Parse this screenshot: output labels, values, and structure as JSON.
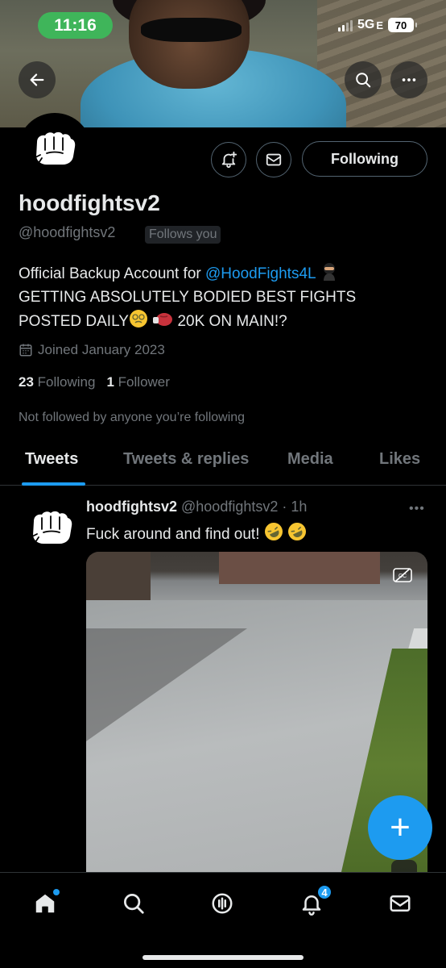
{
  "status_bar": {
    "time": "11:16",
    "network": "5G",
    "network_suffix": "E",
    "battery": "70"
  },
  "header": {
    "back_icon": "arrow-left-icon",
    "search_icon": "search-icon",
    "more_icon": "more-horizontal-icon"
  },
  "profile": {
    "display_name": "hoodfightsv2",
    "handle": "@hoodfightsv2",
    "follows_you": "Follows you",
    "following_button": "Following",
    "bio_prefix": "Official Backup Account for ",
    "bio_mention": "@HoodFights4L",
    "bio_line2": "GETTING ABSOLUTELY BODIED BEST FIGHTS",
    "bio_line3_a": "POSTED DAILY",
    "bio_line3_b": " 20K ON MAIN!?",
    "joined": "Joined January 2023",
    "following_count": "23",
    "following_label": "Following",
    "follower_count": "1",
    "follower_label": "Follower",
    "not_followed": "Not followed by anyone you’re following"
  },
  "tabs": [
    {
      "label": "Tweets",
      "active": true
    },
    {
      "label": "Tweets & replies"
    },
    {
      "label": "Media"
    },
    {
      "label": "Likes"
    }
  ],
  "tweet": {
    "name": "hoodfightsv2",
    "handle": "@hoodfightsv2",
    "separator": "·",
    "time": "1h",
    "more": "•••",
    "text": "Fuck around and find out!"
  },
  "fab": {
    "label": "+"
  },
  "bottom_nav": {
    "notifications_badge": "4"
  },
  "colors": {
    "accent": "#1d9bf0",
    "background": "#000000",
    "muted": "#71767b",
    "time_pill": "#3fb55a"
  }
}
